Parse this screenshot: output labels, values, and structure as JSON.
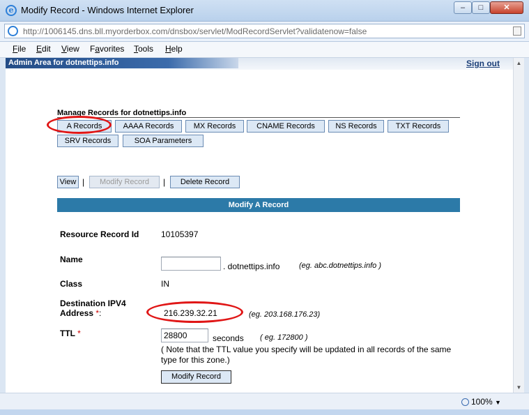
{
  "window": {
    "title": "Modify Record - Windows Internet Explorer",
    "url": "http://1006145.dns.bll.myorderbox.com/dnsbox/servlet/ModRecordServlet?validatenow=false"
  },
  "menu": [
    "File",
    "Edit",
    "View",
    "Favorites",
    "Tools",
    "Help"
  ],
  "menu_underlines": [
    "F",
    "E",
    "V",
    "a",
    "T",
    "H"
  ],
  "admin": {
    "title": "Admin Area for dotnettips.info",
    "signout": "Sign out"
  },
  "manage": {
    "title": "Manage Records for dotnettips.info",
    "tabs": [
      "A Records",
      "AAAA Records",
      "MX Records",
      "CNAME Records",
      "NS Records",
      "TXT Records",
      "SRV Records",
      "SOA Parameters"
    ]
  },
  "actions": {
    "view": "View",
    "modify": "Modify Record",
    "delete": "Delete Record",
    "separator": "|"
  },
  "form": {
    "header": "Modify A Record",
    "rr_id_label": "Resource Record Id",
    "rr_id_value": "10105397",
    "name_label": "Name",
    "name_value": "",
    "name_suffix": ". dotnettips.info",
    "name_hint": "(eg. abc.dotnettips.info )",
    "class_label": "Class",
    "class_value": "IN",
    "dest_label_line1": "Destination IPV4",
    "dest_label_line2": "Address",
    "required_mark": "*",
    "dest_colon": ":",
    "dest_value": "216.239.32.21",
    "dest_hint": "(eg. 203.168.176.23)",
    "ttl_label": "TTL",
    "ttl_value": "28800",
    "ttl_unit": "seconds",
    "ttl_hint": "( eg. 172800 )",
    "ttl_note": "( Note that the TTL value you specify will be updated in all records of the same type for this zone.)",
    "submit": "Modify Record"
  },
  "status": {
    "zoom": "100%"
  },
  "colors": {
    "section_header": "#2c7aa8",
    "annotation": "#e01616",
    "admin_bar": "#234c86"
  }
}
